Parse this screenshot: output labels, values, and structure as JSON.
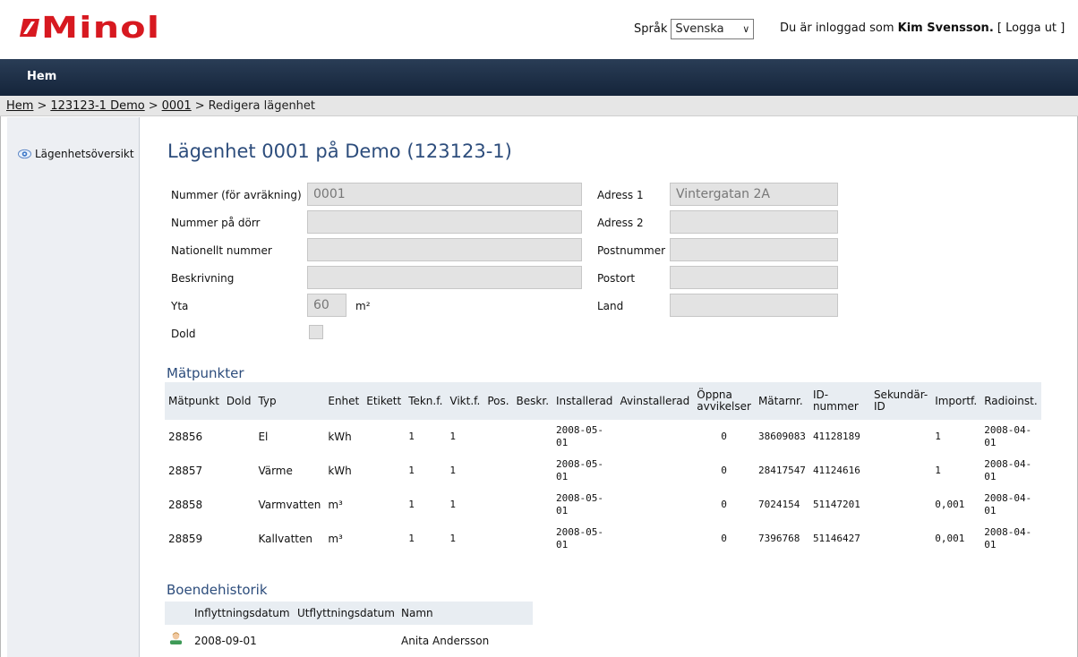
{
  "brand": {
    "logo_text": "Minol",
    "logo_color": "#d71920"
  },
  "header": {
    "lang_label": "Språk",
    "lang_value": "Svenska",
    "login_prefix": "Du är inloggad som",
    "user_name": "Kim Svensson.",
    "logout_open": "[",
    "logout_label": "Logga ut",
    "logout_close": "]"
  },
  "nav": {
    "home": "Hem"
  },
  "breadcrumb": {
    "items": [
      "Hem",
      "123123-1 Demo",
      "0001"
    ],
    "separator": ">",
    "current": "Redigera lägenhet"
  },
  "sidebar": {
    "items": [
      {
        "label": "Lägenhetsöversikt",
        "icon": "eye-icon"
      }
    ]
  },
  "main": {
    "title": "Lägenhet 0001 på Demo (123123-1)",
    "form": {
      "number_label": "Nummer (för avräkning)",
      "number_value": "0001",
      "door_label": "Nummer på dörr",
      "door_value": "",
      "national_label": "Nationellt nummer",
      "national_value": "",
      "desc_label": "Beskrivning",
      "desc_value": "",
      "area_label": "Yta",
      "area_value": "60",
      "area_unit": "m²",
      "hidden_label": "Dold",
      "hidden_checked": false,
      "address1_label": "Adress 1",
      "address1_value": "Vintergatan 2A",
      "address2_label": "Adress 2",
      "address2_value": "",
      "postal_label": "Postnummer",
      "postal_value": "",
      "city_label": "Postort",
      "city_value": "",
      "country_label": "Land",
      "country_value": ""
    },
    "meters": {
      "title": "Mätpunkter",
      "columns": [
        "Mätpunkt",
        "Dold",
        "Typ",
        "Enhet",
        "Etikett",
        "Tekn.f.",
        "Vikt.f.",
        "Pos.",
        "Beskr.",
        "Installerad",
        "Avinstallerad",
        "Öppna avvikelser",
        "Mätarnr.",
        "ID-nummer",
        "Sekundär-ID",
        "Importf.",
        "Radioinst."
      ],
      "rows": [
        {
          "point": "28856",
          "hidden": "",
          "type": "El",
          "unit": "kWh",
          "label": "",
          "tekn": "1",
          "vikt": "1",
          "pos": "",
          "desc": "",
          "installed": "2008-05-01",
          "uninstalled": "",
          "open": "0",
          "meter": "38609083",
          "id": "41128189",
          "secondary": "",
          "import": "1",
          "radio": "2008-04-01"
        },
        {
          "point": "28857",
          "hidden": "",
          "type": "Värme",
          "unit": "kWh",
          "label": "",
          "tekn": "1",
          "vikt": "1",
          "pos": "",
          "desc": "",
          "installed": "2008-05-01",
          "uninstalled": "",
          "open": "0",
          "meter": "28417547",
          "id": "41124616",
          "secondary": "",
          "import": "1",
          "radio": "2008-04-01"
        },
        {
          "point": "28858",
          "hidden": "",
          "type": "Varmvatten",
          "unit": "m³",
          "label": "",
          "tekn": "1",
          "vikt": "1",
          "pos": "",
          "desc": "",
          "installed": "2008-05-01",
          "uninstalled": "",
          "open": "0",
          "meter": "7024154",
          "id": "51147201",
          "secondary": "",
          "import": "0,001",
          "radio": "2008-04-01"
        },
        {
          "point": "28859",
          "hidden": "",
          "type": "Kallvatten",
          "unit": "m³",
          "label": "",
          "tekn": "1",
          "vikt": "1",
          "pos": "",
          "desc": "",
          "installed": "2008-05-01",
          "uninstalled": "",
          "open": "0",
          "meter": "7396768",
          "id": "51146427",
          "secondary": "",
          "import": "0,001",
          "radio": "2008-04-01"
        }
      ]
    },
    "history": {
      "title": "Boendehistorik",
      "columns": [
        "Inflyttningsdatum",
        "Utflyttningsdatum",
        "Namn"
      ],
      "rows": [
        {
          "icon": "person-icon",
          "move_in": "2008-09-01",
          "move_out": "",
          "name": "Anita Andersson"
        }
      ]
    }
  }
}
